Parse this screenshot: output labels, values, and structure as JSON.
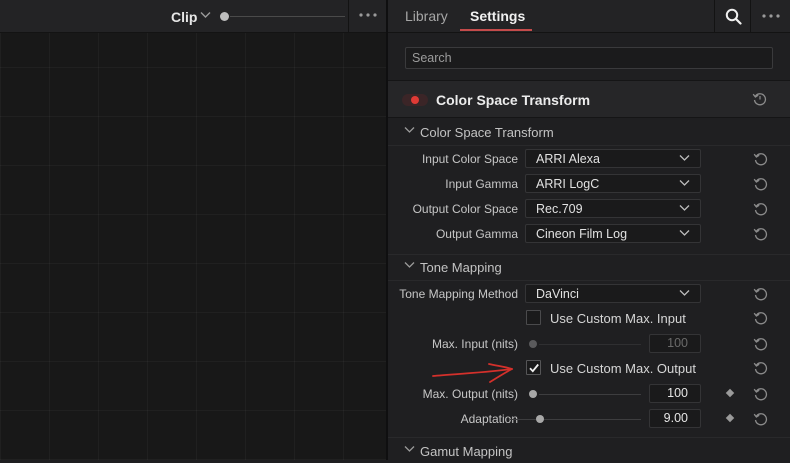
{
  "left_toolbar": {
    "clip_label": "Clip"
  },
  "tabs": {
    "library": "Library",
    "settings": "Settings"
  },
  "search": {
    "placeholder": "Search"
  },
  "effect": {
    "title": "Color Space Transform",
    "enabled": true
  },
  "sections": {
    "cst": {
      "title": "Color Space Transform",
      "rows": [
        {
          "label": "Input Color Space",
          "value": "ARRI Alexa"
        },
        {
          "label": "Input Gamma",
          "value": "ARRI LogC"
        },
        {
          "label": "Output Color Space",
          "value": "Rec.709"
        },
        {
          "label": "Output Gamma",
          "value": "Cineon Film Log"
        }
      ]
    },
    "tone": {
      "title": "Tone Mapping",
      "method_label": "Tone Mapping Method",
      "method_value": "DaVinci",
      "custom_input_label": "Use Custom Max. Input",
      "custom_input_checked": false,
      "max_input_label": "Max. Input (nits)",
      "max_input_value": "100",
      "custom_output_label": "Use Custom Max. Output",
      "custom_output_checked": true,
      "max_output_label": "Max. Output (nits)",
      "max_output_value": "100",
      "adaptation_label": "Adaptation",
      "adaptation_value": "9.00"
    },
    "gamut": {
      "title": "Gamut Mapping"
    }
  },
  "colors": {
    "accent": "#c44b4b",
    "toggle_on": "#e03a35",
    "annotation": "#d4302b"
  },
  "icons": [
    "chevron-down-icon",
    "more-icon",
    "search-icon",
    "reset-icon",
    "keyframe-diamond-icon",
    "checkmark-icon",
    "annotation-arrow"
  ]
}
